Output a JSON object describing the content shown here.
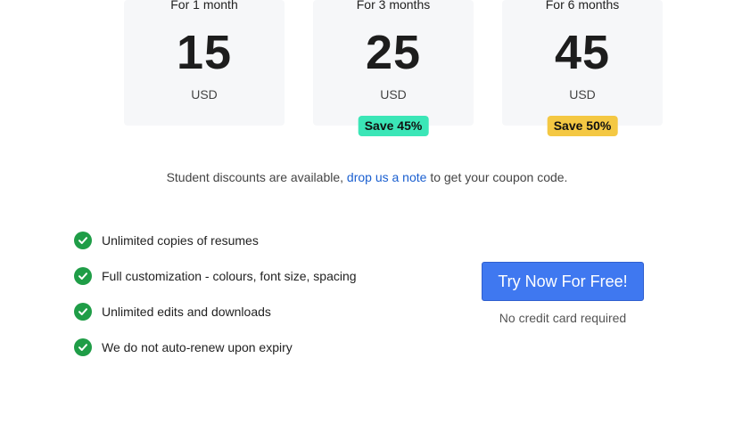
{
  "plans": [
    {
      "period": "For 1 month",
      "price": "15",
      "currency": "USD",
      "badge": null
    },
    {
      "period": "For 3 months",
      "price": "25",
      "currency": "USD",
      "badge": {
        "text": "Save 45%",
        "color": "#3be6b7"
      }
    },
    {
      "period": "For 6 months",
      "price": "45",
      "currency": "USD",
      "badge": {
        "text": "Save 50%",
        "color": "#f4c843"
      }
    }
  ],
  "discount": {
    "before": "Student discounts are available, ",
    "link": "drop us a note",
    "after": " to get your coupon code."
  },
  "features": [
    "Unlimited copies of resumes",
    "Full customization - colours, font size, spacing",
    "Unlimited edits and downloads",
    "We do not auto-renew upon expiry"
  ],
  "cta": {
    "label": "Try Now For Free!",
    "note": "No credit card required"
  },
  "colors": {
    "check": "#1f9d47",
    "cta": "#3f78f0",
    "link": "#1a5fd0"
  }
}
